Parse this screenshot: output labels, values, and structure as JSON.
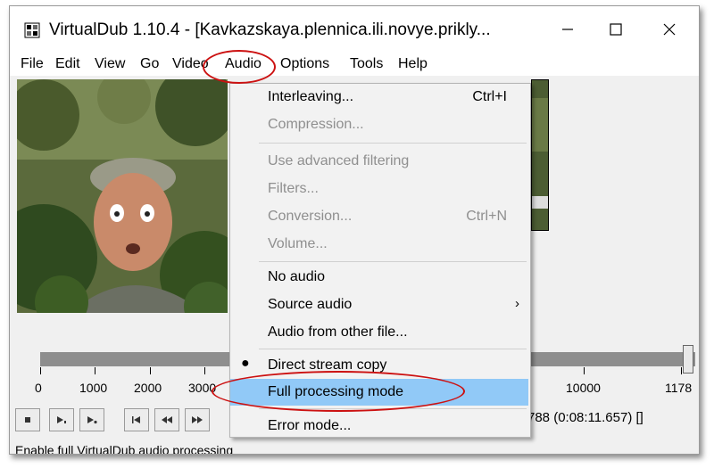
{
  "window": {
    "title": "VirtualDub 1.10.4 - [Kavkazskaya.plennica.ili.novye.prikly..."
  },
  "menubar": {
    "items": [
      "File",
      "Edit",
      "View",
      "Go",
      "Video",
      "Audio",
      "Options",
      "Tools",
      "Help"
    ]
  },
  "audio_menu": {
    "items": [
      {
        "label": "Interleaving...",
        "shortcut": "Ctrl+I",
        "enabled": true
      },
      {
        "label": "Compression...",
        "shortcut": "",
        "enabled": false
      },
      {
        "label": "Use advanced filtering",
        "shortcut": "",
        "enabled": false
      },
      {
        "label": "Filters...",
        "shortcut": "",
        "enabled": false
      },
      {
        "label": "Conversion...",
        "shortcut": "Ctrl+N",
        "enabled": false
      },
      {
        "label": "Volume...",
        "shortcut": "",
        "enabled": false
      },
      {
        "label": "No audio",
        "shortcut": "",
        "enabled": true
      },
      {
        "label": "Source audio",
        "shortcut": "",
        "enabled": true,
        "submenu_arrow": "›"
      },
      {
        "label": "Audio from other file...",
        "shortcut": "",
        "enabled": true
      },
      {
        "label": "Direct stream copy",
        "shortcut": "",
        "enabled": true,
        "checked_mark": "●"
      },
      {
        "label": "Full processing mode",
        "shortcut": "",
        "enabled": true,
        "highlighted": true
      },
      {
        "label": "Error mode...",
        "shortcut": "",
        "enabled": true
      }
    ]
  },
  "timeline": {
    "ticks": [
      "0",
      "1000",
      "2000",
      "3000",
      "10000",
      "1178"
    ]
  },
  "frame_info": "788 (0:08:11.657) []",
  "status_text": "Enable full VirtualDub audio processing",
  "colors": {
    "highlight": "#91c9f7",
    "annotation": "#cc1111",
    "disabled_text": "#8f8f8f"
  }
}
